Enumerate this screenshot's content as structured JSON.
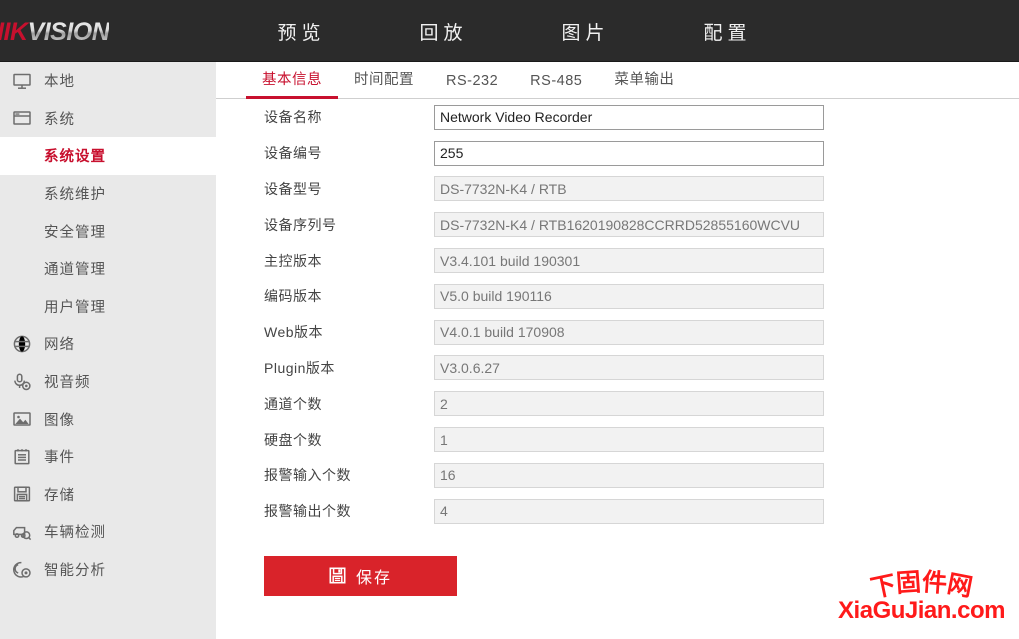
{
  "brand": {
    "logo_hik": "HIK",
    "logo_vision": "VISION",
    "accent_red": "#c8102e",
    "header_bg": "#2b2b2b",
    "sidebar_bg": "#e9e9e9"
  },
  "nav": {
    "items": [
      {
        "label": "预览",
        "name": "nav-preview"
      },
      {
        "label": "回放",
        "name": "nav-playback"
      },
      {
        "label": "图片",
        "name": "nav-picture"
      },
      {
        "label": "配置",
        "name": "nav-configuration"
      }
    ]
  },
  "sidebar": {
    "items": [
      {
        "label": "本地",
        "icon": "monitor-icon",
        "level": "top",
        "active": false
      },
      {
        "label": "系统",
        "icon": "window-icon",
        "level": "top",
        "active": false
      },
      {
        "label": "系统设置",
        "icon": "",
        "level": "sub",
        "active": true
      },
      {
        "label": "系统维护",
        "icon": "",
        "level": "sub",
        "active": false
      },
      {
        "label": "安全管理",
        "icon": "",
        "level": "sub",
        "active": false
      },
      {
        "label": "通道管理",
        "icon": "",
        "level": "sub",
        "active": false
      },
      {
        "label": "用户管理",
        "icon": "",
        "level": "sub",
        "active": false
      },
      {
        "label": "网络",
        "icon": "globe-icon",
        "level": "top",
        "active": false
      },
      {
        "label": "视音频",
        "icon": "microphone-icon",
        "level": "top",
        "active": false
      },
      {
        "label": "图像",
        "icon": "picture-icon",
        "level": "top",
        "active": false
      },
      {
        "label": "事件",
        "icon": "notepad-icon",
        "level": "top",
        "active": false
      },
      {
        "label": "存储",
        "icon": "floppy-icon",
        "level": "top",
        "active": false
      },
      {
        "label": "车辆检测",
        "icon": "vehicle-search-icon",
        "level": "top",
        "active": false
      },
      {
        "label": "智能分析",
        "icon": "smart-analysis-icon",
        "level": "top",
        "active": false
      }
    ]
  },
  "tabs": [
    {
      "label": "基本信息",
      "name": "tab-basic-info",
      "active": true
    },
    {
      "label": "时间配置",
      "name": "tab-time-config",
      "active": false
    },
    {
      "label": "RS-232",
      "name": "tab-rs232",
      "active": false
    },
    {
      "label": "RS-485",
      "name": "tab-rs485",
      "active": false
    },
    {
      "label": "菜单输出",
      "name": "tab-menu-output",
      "active": false
    }
  ],
  "form": {
    "fields": [
      {
        "label": "设备名称",
        "value": "Network Video Recorder",
        "name": "device-name",
        "readonly": false
      },
      {
        "label": "设备编号",
        "value": "255",
        "name": "device-number",
        "readonly": false
      },
      {
        "label": "设备型号",
        "value": "DS-7732N-K4 / RTB",
        "name": "device-model",
        "readonly": true
      },
      {
        "label": "设备序列号",
        "value": "DS-7732N-K4 / RTB1620190828CCRRD52855160WCVU",
        "name": "device-serial-number",
        "readonly": true
      },
      {
        "label": "主控版本",
        "value": "V3.4.101 build 190301",
        "name": "firmware-version",
        "readonly": true
      },
      {
        "label": "编码版本",
        "value": "V5.0 build 190116",
        "name": "encoding-version",
        "readonly": true
      },
      {
        "label": "Web版本",
        "value": "V4.0.1 build 170908",
        "name": "web-version",
        "readonly": true
      },
      {
        "label": "Plugin版本",
        "value": "V3.0.6.27",
        "name": "plugin-version",
        "readonly": true
      },
      {
        "label": "通道个数",
        "value": "2",
        "name": "channel-count",
        "readonly": true
      },
      {
        "label": "硬盘个数",
        "value": "1",
        "name": "hdd-count",
        "readonly": true
      },
      {
        "label": "报警输入个数",
        "value": "16",
        "name": "alarm-input-count",
        "readonly": true
      },
      {
        "label": "报警输出个数",
        "value": "4",
        "name": "alarm-output-count",
        "readonly": true
      }
    ],
    "save_label": "保存"
  },
  "watermark": {
    "cn_chars": [
      "下",
      "固",
      "件",
      "网"
    ],
    "site": "XiaGuJian.com",
    "color": "#ff1a1a"
  }
}
